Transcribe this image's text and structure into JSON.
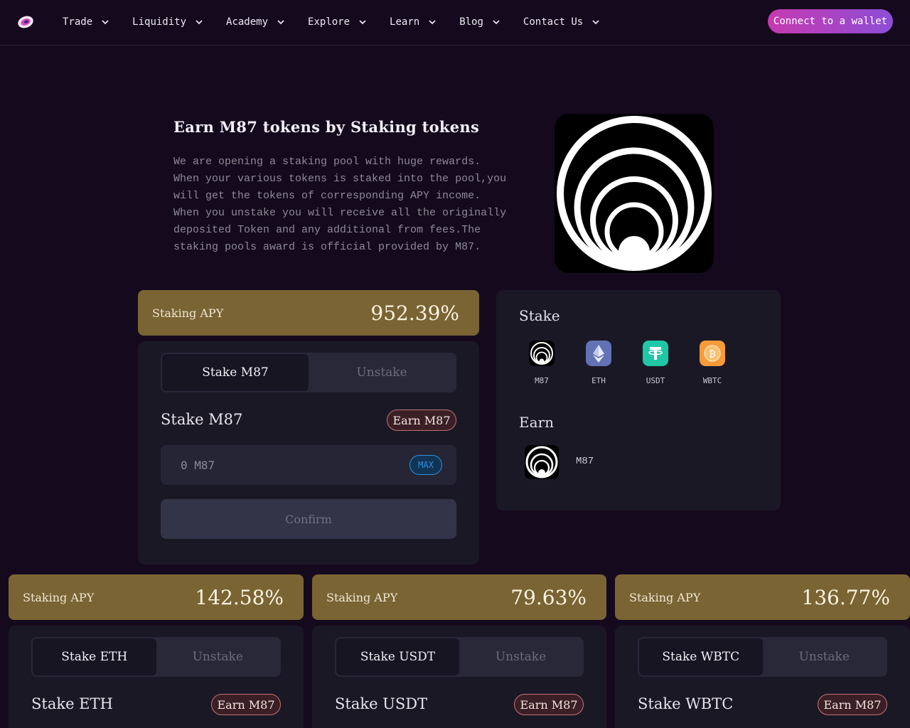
{
  "header": {
    "nav": [
      "Trade",
      "Liquidity",
      "Academy",
      "Explore",
      "Learn",
      "Blog",
      "Contact Us"
    ],
    "connect_label": "Connect to a wallet"
  },
  "hero": {
    "title": "Earn M87 tokens by Staking tokens",
    "description": "We are opening a staking pool with huge rewards. When your various tokens is staked into the pool,you will get the tokens of corresponding APY income. When you unstake you will receive all the originally deposited Token and any additional from fees.The staking pools award is official provided by M87."
  },
  "main_pool": {
    "apy_label": "Staking APY",
    "apy_value": "952.39%",
    "tab_stake": "Stake M87",
    "tab_unstake": "Unstake",
    "title": "Stake M87",
    "earn_badge": "Earn M87",
    "amount_placeholder": "0 M87",
    "max_label": "MAX",
    "confirm_label": "Confirm"
  },
  "token_panel": {
    "stake_title": "Stake",
    "tokens": [
      "M87",
      "ETH",
      "USDT",
      "WBTC"
    ],
    "earn_title": "Earn",
    "earn_token": "M87"
  },
  "pools": [
    {
      "apy_label": "Staking APY",
      "apy_value": "142.58%",
      "tab_stake": "Stake ETH",
      "tab_unstake": "Unstake",
      "title": "Stake ETH",
      "earn_badge": "Earn M87"
    },
    {
      "apy_label": "Staking APY",
      "apy_value": "79.63%",
      "tab_stake": "Stake USDT",
      "tab_unstake": "Unstake",
      "title": "Stake USDT",
      "earn_badge": "Earn M87"
    },
    {
      "apy_label": "Staking APY",
      "apy_value": "136.77%",
      "tab_stake": "Stake WBTC",
      "tab_unstake": "Unstake",
      "title": "Stake WBTC",
      "earn_badge": "Earn M87"
    }
  ],
  "colors": {
    "background": "#150a1d",
    "apy_bar": "#7a6434",
    "panel": "#1b1826",
    "accent_pink": "#c63ab0",
    "accent_purple": "#8d4dd6",
    "max_blue": "#2f8fe0"
  },
  "icons": [
    "m87-logo-icon",
    "chevron-down-icon",
    "eth-icon",
    "usdt-icon",
    "wbtc-icon"
  ]
}
